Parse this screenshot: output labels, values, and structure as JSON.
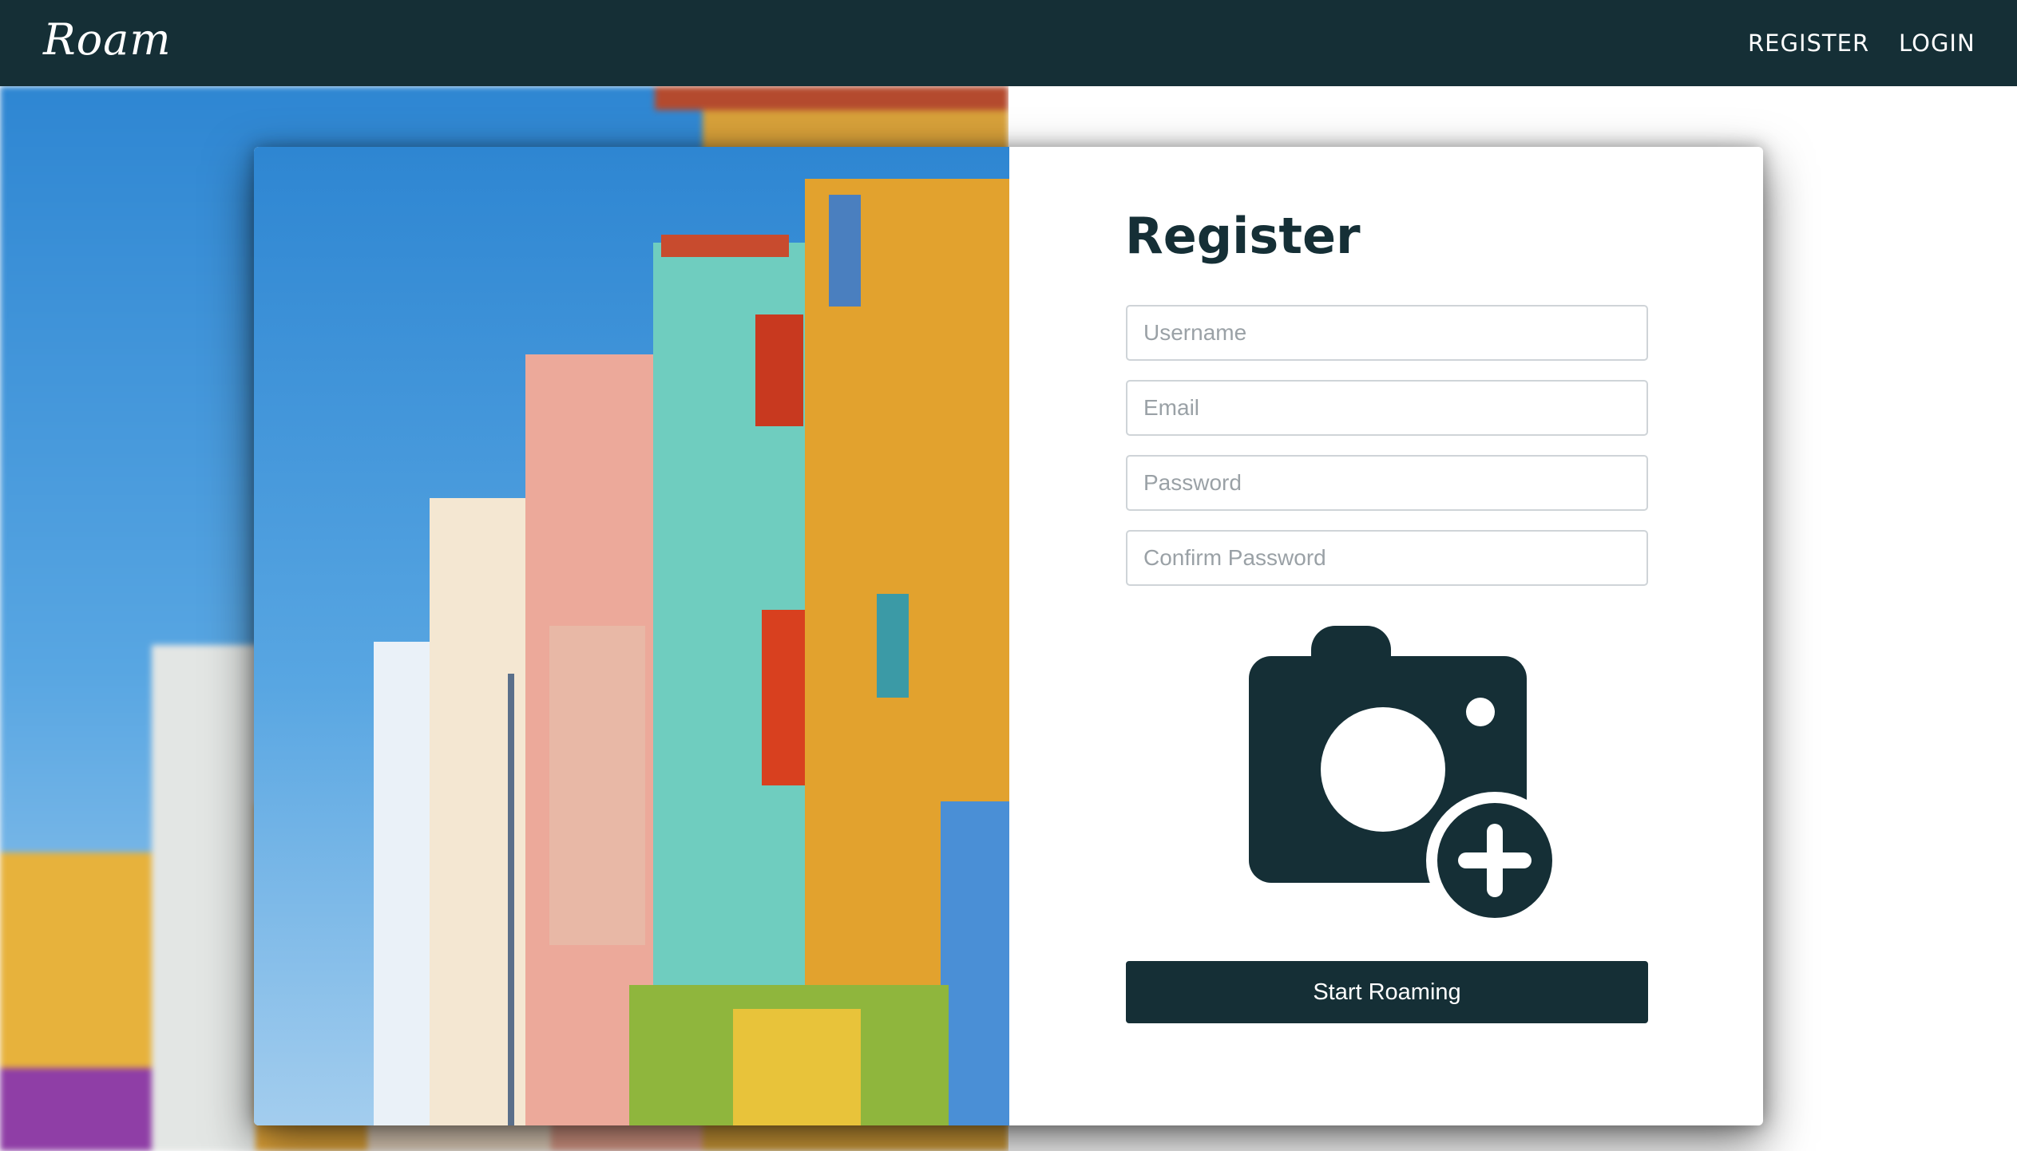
{
  "app": {
    "name": "Roam"
  },
  "nav": {
    "register_label": "REGISTER",
    "login_label": "LOGIN"
  },
  "form": {
    "title": "Register",
    "username_placeholder": "Username",
    "email_placeholder": "Email",
    "password_placeholder": "Password",
    "confirm_password_placeholder": "Confirm Password",
    "upload_icon": "camera-plus-icon",
    "submit_label": "Start Roaming"
  },
  "colors": {
    "primary": "#152f36",
    "white": "#ffffff"
  }
}
